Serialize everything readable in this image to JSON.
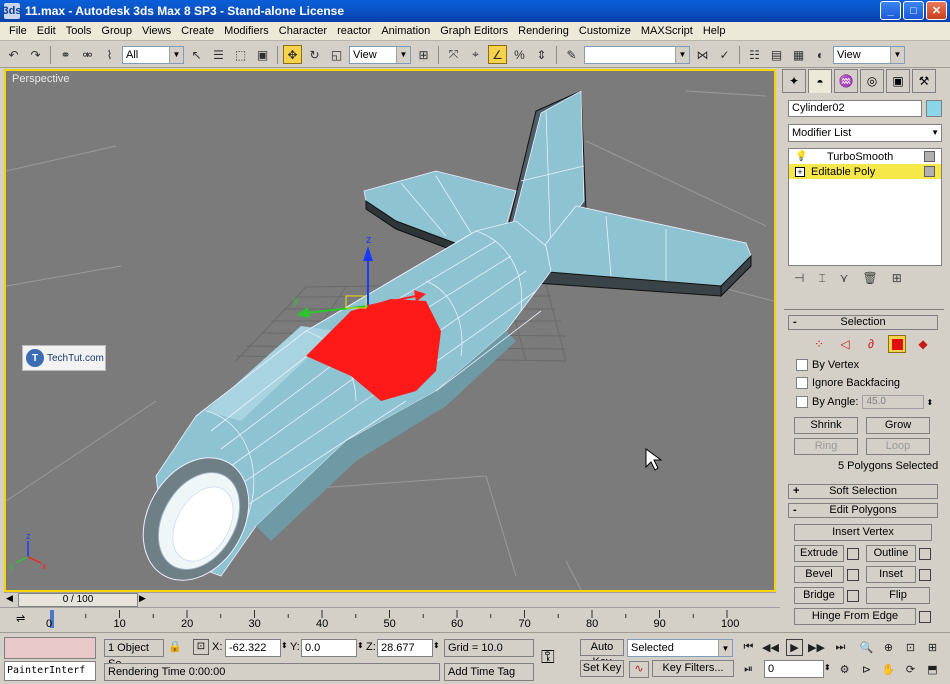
{
  "window": {
    "title": "11.max - Autodesk 3ds Max 8 SP3 - Stand-alone License",
    "app_icon": "3ds",
    "min": "_",
    "max": "□",
    "close": "✕"
  },
  "menu": [
    "File",
    "Edit",
    "Tools",
    "Group",
    "Views",
    "Create",
    "Modifiers",
    "Character",
    "reactor",
    "Animation",
    "Graph Editors",
    "Rendering",
    "Customize",
    "MAXScript",
    "Help"
  ],
  "toolbar": {
    "filter": "All",
    "ref_coord": "View",
    "named_sel": "",
    "view_right": "View"
  },
  "viewport": {
    "label": "Perspective",
    "watermark_logo": "T",
    "watermark": "TechTut.com",
    "axes": {
      "x": "x",
      "y": "y",
      "z": "z"
    }
  },
  "command_panel": {
    "object_name": "Cylinder02",
    "modifier_list": "Modifier List",
    "stack": [
      {
        "label": "TurboSmooth",
        "selected": false
      },
      {
        "label": "Editable Poly",
        "selected": true
      }
    ],
    "rollouts": {
      "selection": {
        "title": "Selection",
        "by_vertex": "By Vertex",
        "ignore_backfacing": "Ignore Backfacing",
        "by_angle": "By Angle:",
        "angle_value": "45.0",
        "shrink": "Shrink",
        "grow": "Grow",
        "ring": "Ring",
        "loop": "Loop",
        "status": "5 Polygons Selected"
      },
      "soft_selection": {
        "title": "Soft Selection"
      },
      "edit_polygons": {
        "title": "Edit Polygons",
        "insert_vertex": "Insert Vertex",
        "extrude": "Extrude",
        "outline": "Outline",
        "bevel": "Bevel",
        "inset": "Inset",
        "bridge": "Bridge",
        "flip": "Flip",
        "hinge": "Hinge From Edge"
      }
    }
  },
  "timeline": {
    "position": "0 / 100",
    "ticks": [
      "0",
      "10",
      "20",
      "30",
      "40",
      "50",
      "60",
      "70",
      "80",
      "90",
      "100"
    ]
  },
  "status": {
    "objects_selected": "1 Object Se",
    "x_label": "X:",
    "x_value": "-62.322",
    "y_label": "Y:",
    "y_value": "0.0",
    "z_label": "Z:",
    "z_value": "28.677",
    "grid": "Grid = 10.0",
    "auto_key": "Auto Key",
    "selected_dropdown": "Selected",
    "set_key": "Set Key",
    "key_filters": "Key Filters...",
    "frame": "0",
    "rendering_time": "Rendering Time  0:00:00",
    "add_time_tag": "Add Time Tag",
    "maxscript": "PainterInterf"
  },
  "colors": {
    "viewport_bg": "#7b7b7b",
    "active_border": "#f5d400",
    "model": "#8ec3d1",
    "selection": "#ff1a1a"
  }
}
